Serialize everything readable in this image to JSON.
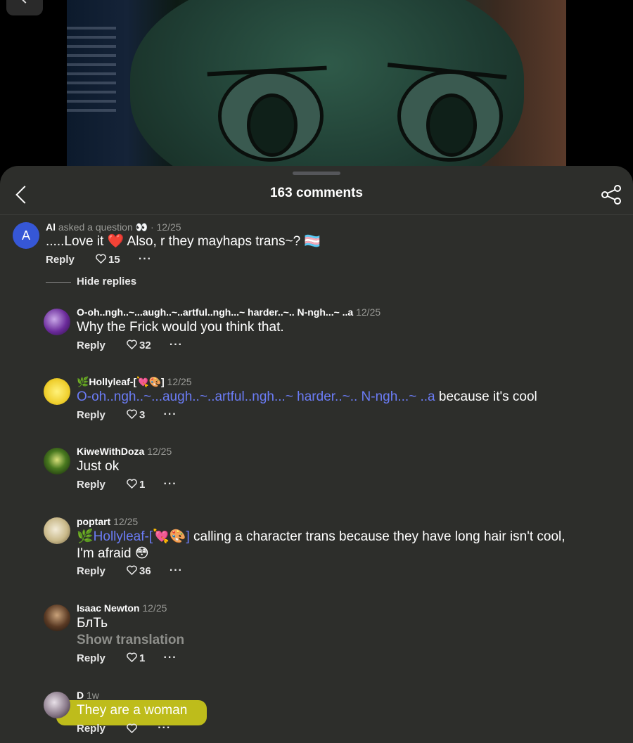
{
  "header": {
    "title": "163 comments"
  },
  "comments": {
    "c1": {
      "avatar_letter": "A",
      "name": "Al",
      "question": "asked a question 👀",
      "date": "· 12/25",
      "text": ".....Love it ❤️ Also, r they mayhaps trans~? 🏳️‍⚧️",
      "reply": "Reply",
      "likes": "15"
    },
    "hide_replies": "Hide replies",
    "c2": {
      "name": "O-oh..ngh..~...augh..~..artful..ngh...~ harder..~.. N-ngh...~ ..a",
      "date": "12/25",
      "text": "Why the Frick would you think that.",
      "reply": "Reply",
      "likes": "32"
    },
    "c3": {
      "name": "🌿Hollyleaf-[💘🎨]",
      "date": "12/25",
      "mention": "O-oh..ngh..~...augh..~..artful..ngh...~ harder..~.. N-ngh...~ ..a",
      "text": " because it's cool",
      "reply": "Reply",
      "likes": "3"
    },
    "c4": {
      "name": "KiweWithDoza",
      "date": "12/25",
      "text": "Just ok",
      "reply": "Reply",
      "likes": "1"
    },
    "c5": {
      "name": "poptart",
      "date": "12/25",
      "mention": "🌿Hollyleaf-[💘🎨]",
      "text": " calling a character trans because they have long hair isn't cool,",
      "text2": "I'm afraid 😳",
      "reply": "Reply",
      "likes": "36"
    },
    "c6": {
      "name": "Isaac Newton",
      "date": "12/25",
      "text": "БлТь",
      "translation": "Show translation",
      "reply": "Reply",
      "likes": "1"
    },
    "c7": {
      "name": "D",
      "date": "1w",
      "text": "They are a woman",
      "reply": "Reply",
      "likes": ""
    }
  },
  "colors": {
    "sheet": "#2d2e2b",
    "mention": "#6b7cf6",
    "highlight": "#c6c41a",
    "avatar_a": "#3657d6"
  }
}
